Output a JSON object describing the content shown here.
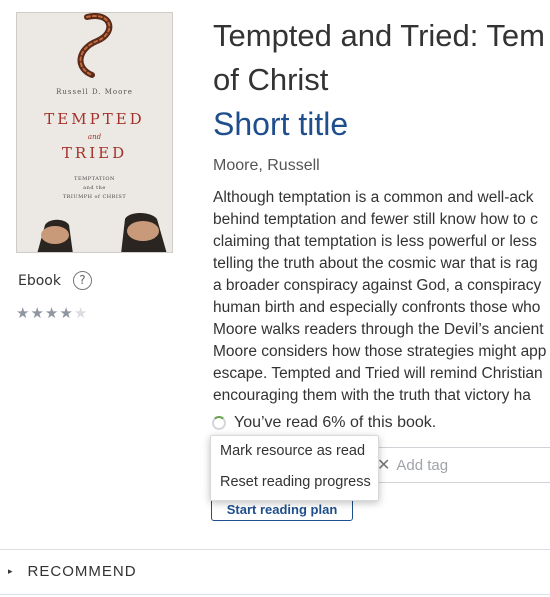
{
  "book": {
    "title": "Tempted and Tried: Temptation and the Triumph of Christ",
    "title_line1": "Tempted and Tried: Tem",
    "title_line2": "of Christ",
    "short_title": "Short title",
    "author": "Moore, Russell",
    "description_lines": [
      "Although temptation is a common and well-ack",
      "behind temptation and fewer still know how to c",
      "claiming that temptation is less powerful or less",
      "telling the truth about the cosmic war that is rag",
      "a broader conspiracy against God, a conspiracy",
      "human birth and especially confronts those who",
      "Moore walks readers through the Devil’s ancient",
      "Moore considers how those strategies might app",
      "escape. Tempted and Tried will remind Christian",
      "encouraging them with the truth that victory ha"
    ]
  },
  "cover": {
    "author": "Russell D. Moore",
    "title_word1": "TEMPTED",
    "and": "and",
    "title_word2": "TRIED",
    "subtitle_line1": "TEMPTATION",
    "subtitle_line2": "and the",
    "subtitle_line3": "TRIUMPH of CHRIST"
  },
  "format": {
    "label": "Ebook",
    "help_icon": "question-circle-icon",
    "help_glyph": "?"
  },
  "rating": {
    "filled": 4,
    "total": 5
  },
  "progress": {
    "text": "You’ve read 6% of this book.",
    "percent": 6
  },
  "context_menu": {
    "items": [
      "Mark resource as read",
      "Reset reading progress"
    ]
  },
  "tags": {
    "placeholder": "Add tag",
    "remove_glyph": "✕"
  },
  "buttons": {
    "start_plan": "Start reading plan"
  },
  "sections": {
    "recommend": "RECOMMEND",
    "chevron": "▸"
  },
  "colors": {
    "link_blue": "#1f4e8c",
    "cover_red": "#a3322a",
    "progress_green": "#6ba24f"
  }
}
